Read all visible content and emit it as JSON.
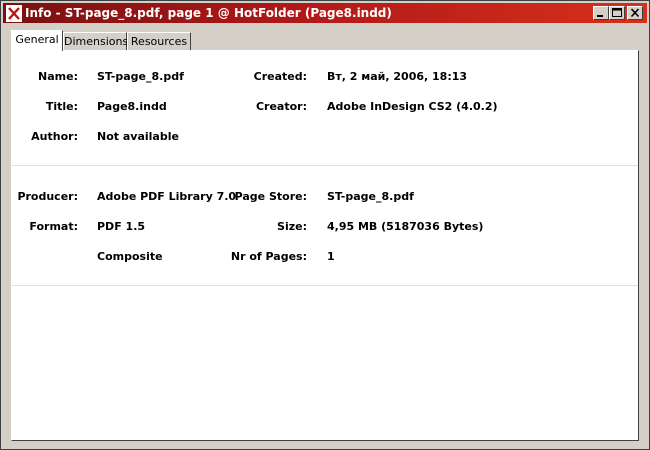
{
  "window": {
    "title": "Info - ST-page_8.pdf, page 1 @ HotFolder (Page8.indd)",
    "icon": "x-app-icon",
    "controls": [
      "minimize-icon",
      "maximize-icon",
      "close-icon"
    ]
  },
  "tabs": [
    {
      "label": "General",
      "active": true
    },
    {
      "label": "Dimensions",
      "active": false
    },
    {
      "label": "Resources",
      "active": false
    }
  ],
  "general": {
    "section1": {
      "name_label": "Name:",
      "name_value": "ST-page_8.pdf",
      "title_label": "Title:",
      "title_value": "Page8.indd",
      "author_label": "Author:",
      "author_value": "Not available",
      "created_label": "Created:",
      "created_value": "Вт, 2 май, 2006, 18:13",
      "creator_label": "Creator:",
      "creator_value": "Adobe InDesign CS2 (4.0.2)"
    },
    "section2": {
      "producer_label": "Producer:",
      "producer_value": "Adobe PDF Library 7.0",
      "format_label": "Format:",
      "format_value": "PDF 1.5",
      "composite_value": "Composite",
      "pagestore_label": "Page Store:",
      "pagestore_value": "ST-page_8.pdf",
      "size_label": "Size:",
      "size_value": "4,95 MB (5187036 Bytes)",
      "pages_label": "Nr of Pages:",
      "pages_value": "1"
    }
  },
  "colors": {
    "titlebar_start": "#7a1010",
    "titlebar_end": "#d6301c",
    "chrome": "#d4d0c8",
    "panel": "#ffffff"
  }
}
